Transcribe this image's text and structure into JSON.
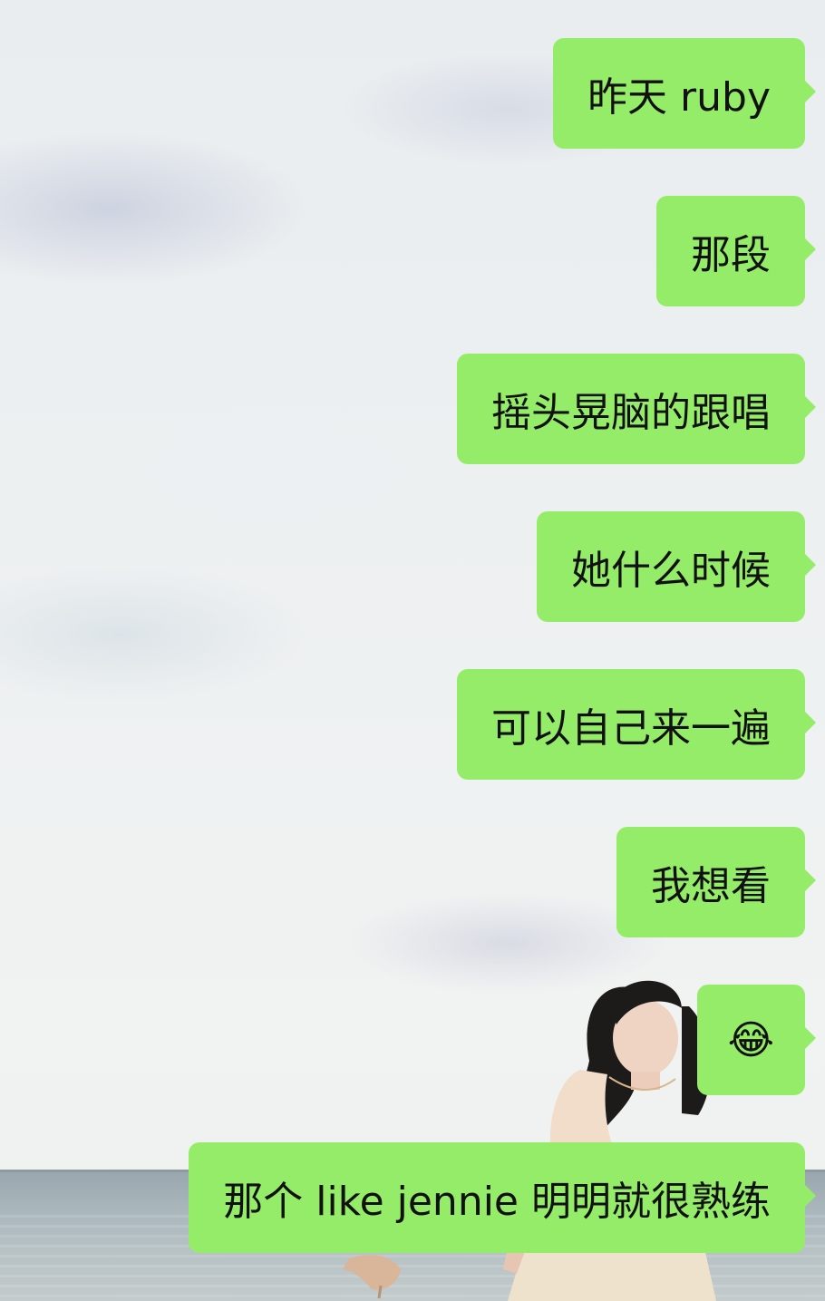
{
  "messages": [
    {
      "text": "昨天 ruby"
    },
    {
      "text": "那段"
    },
    {
      "text": "摇头晃脑的跟唱"
    },
    {
      "text": "她什么时候"
    },
    {
      "text": "可以自己来一遍"
    },
    {
      "text": "我想看"
    },
    {
      "text": "😂"
    },
    {
      "text": "那个 like jennie 明明就很熟练"
    }
  ],
  "colors": {
    "bubble": "#95ec69",
    "text": "#111111"
  }
}
